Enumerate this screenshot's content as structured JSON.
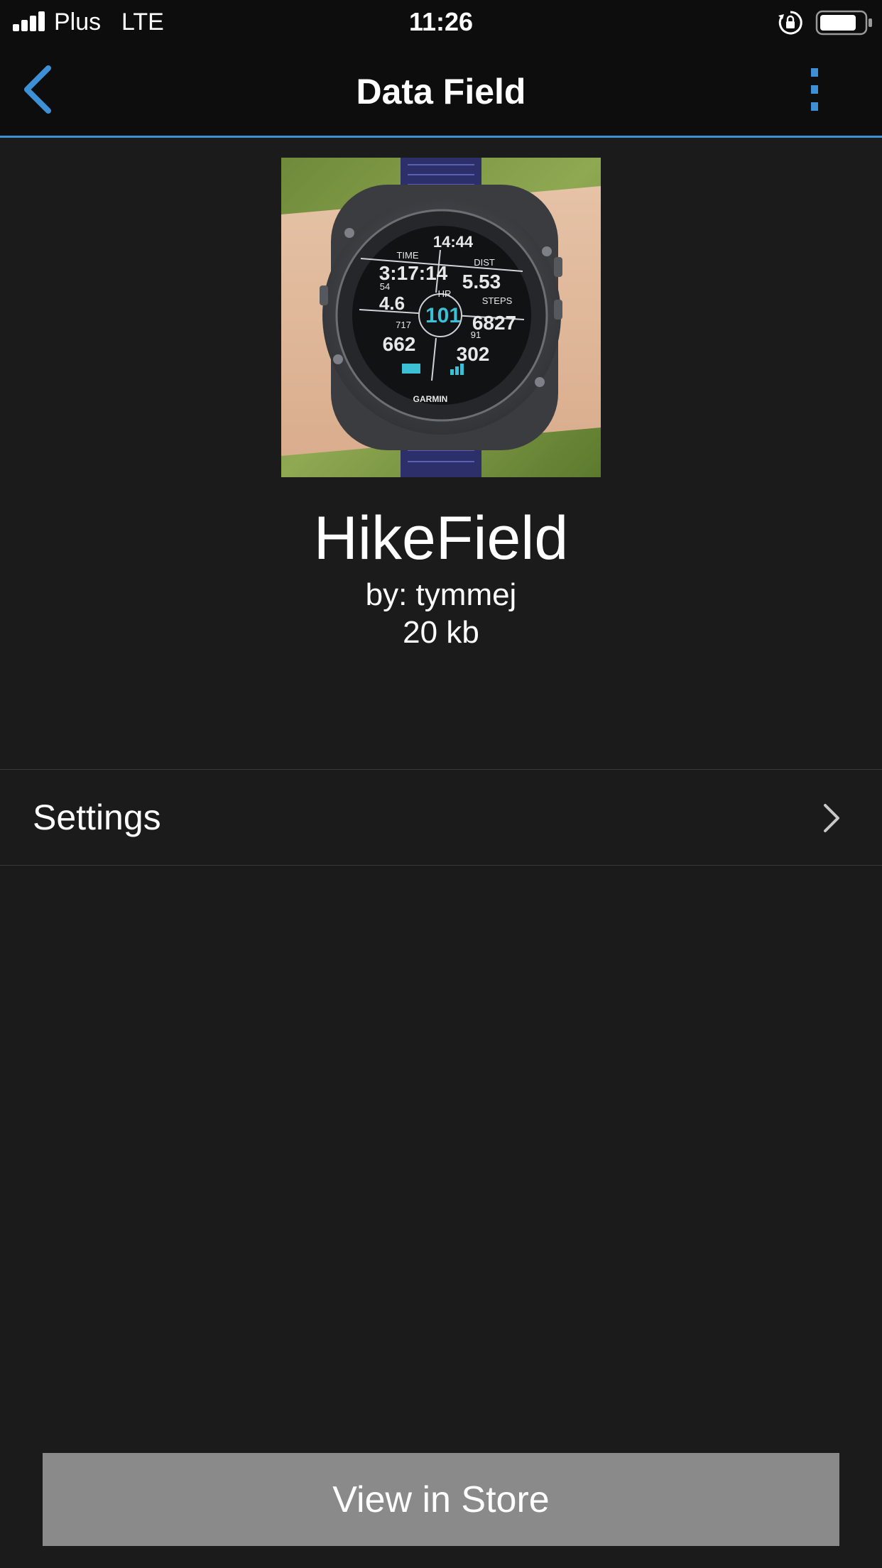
{
  "status_bar": {
    "carrier": "Plus",
    "network": "LTE",
    "time": "11:26"
  },
  "header": {
    "title": "Data Field",
    "back_icon": "chevron-left-icon",
    "menu_icon": "more-vertical-icon",
    "accent_color": "#3d8fd6"
  },
  "watch_face": {
    "time": "14:44",
    "time_label": "TIME",
    "time_value": "3:17:14",
    "dist_label": "DIST",
    "dist_value": "5.53",
    "left_small": "54",
    "left_value": "4.6",
    "hr_label": "HR",
    "hr_value": "101",
    "steps_label": "STEPS",
    "steps_value": "6827",
    "bottom_left_small": "717",
    "bottom_left_value": "662",
    "bottom_right_small": "91",
    "bottom_right_value": "302",
    "brand": "GARMIN"
  },
  "app": {
    "name": "HikeField",
    "author": "by: tymmej",
    "size": "20 kb"
  },
  "settings": {
    "label": "Settings",
    "icon": "chevron-right-icon"
  },
  "store_button": {
    "label": "View in Store",
    "color": "#8a8a8a"
  }
}
